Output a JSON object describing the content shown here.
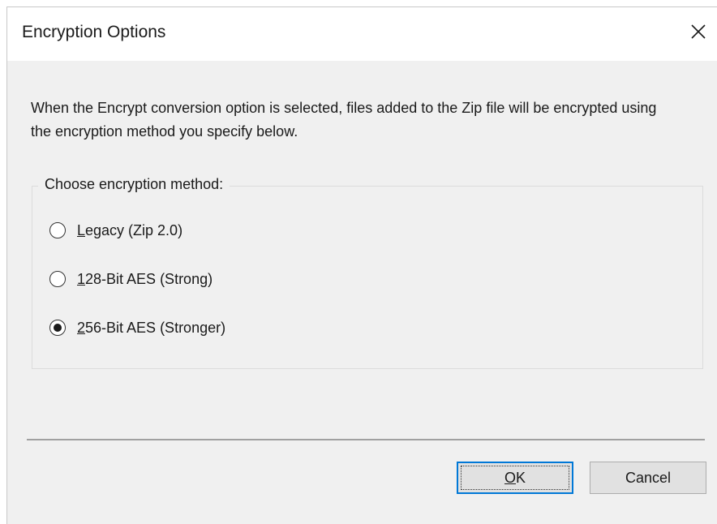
{
  "window": {
    "title": "Encryption Options",
    "close_label": "Close"
  },
  "description": "When the Encrypt conversion option is selected, files added to the Zip file will be encrypted using the encryption method you specify below.",
  "encryption_group": {
    "legend": "Choose encryption method:",
    "options": [
      {
        "mnemonic": "L",
        "rest": "egacy (Zip 2.0)",
        "selected": false
      },
      {
        "mnemonic": "1",
        "rest": "28-Bit AES (Strong)",
        "selected": false
      },
      {
        "mnemonic": "2",
        "rest": "56-Bit AES (Stronger)",
        "selected": true
      }
    ]
  },
  "buttons": {
    "ok_mnemonic": "O",
    "ok_rest": "K",
    "cancel_label": "Cancel"
  },
  "colors": {
    "dialog_background": "#f0f0f0",
    "titlebar_background": "#ffffff",
    "default_button_border": "#0078d7"
  },
  "icons": {
    "close": "close-icon"
  }
}
